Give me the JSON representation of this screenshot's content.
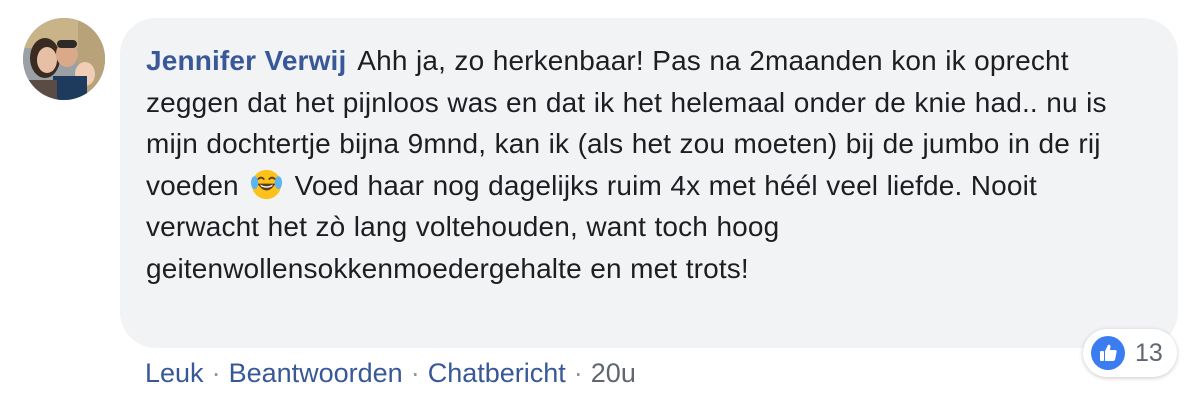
{
  "comment": {
    "author": "Jennifer Verwij",
    "text_part1": "Ahh ja, zo herkenbaar! Pas na 2maanden kon ik oprecht zeggen dat het pijnloos was en dat ik het helemaal onder de knie had.. nu is mijn dochtertje bijna 9mnd, kan ik (als het zou moeten) bij de jumbo in de rij voeden",
    "emoji": "laughing-tears-emoji",
    "text_part2": "Voed haar nog dagelijks ruim 4x met héél veel liefde. Nooit verwacht het zò lang voltehouden, want toch hoog geitenwollensokkenmoedergehalte en met trots!"
  },
  "reactions": {
    "icon": "thumbs-up-icon",
    "count": "13"
  },
  "actions": {
    "like": "Leuk",
    "reply": "Beantwoorden",
    "message": "Chatbericht",
    "separator": "·",
    "timestamp": "20u"
  },
  "colors": {
    "link": "#385898",
    "bubble": "#f2f3f5",
    "text": "#1c1e21",
    "like_badge": "#3b7cf0",
    "meta": "#606770"
  }
}
